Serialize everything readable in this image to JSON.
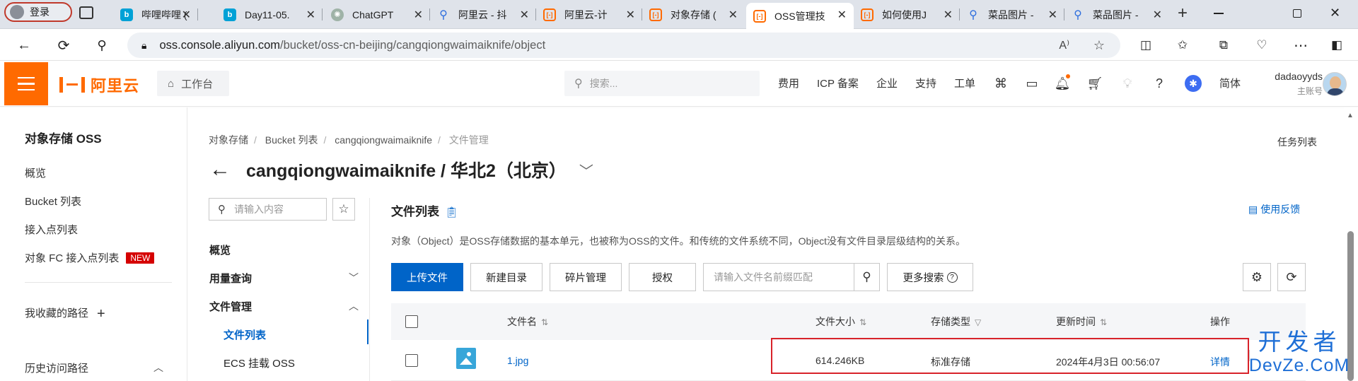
{
  "browser": {
    "login_label": "登录",
    "tabs": [
      {
        "label": "哔哩哔哩 (",
        "icon": "bilibili-icon"
      },
      {
        "label": "Day11-05.",
        "icon": "bilibili-icon"
      },
      {
        "label": "ChatGPT",
        "icon": "chatgpt-icon"
      },
      {
        "label": "阿里云 - 抖",
        "icon": "search-icon"
      },
      {
        "label": "阿里云-计",
        "icon": "aliyun-icon"
      },
      {
        "label": "对象存储 (",
        "icon": "aliyun-icon"
      },
      {
        "label": "OSS管理技",
        "icon": "aliyun-icon"
      },
      {
        "label": "如何使用J",
        "icon": "aliyun-icon"
      },
      {
        "label": "菜品图片 -",
        "icon": "search-icon"
      },
      {
        "label": "菜品图片 -",
        "icon": "search-icon"
      }
    ],
    "url_host": "oss.console.aliyun.com",
    "url_path": "/bucket/oss-cn-beijing/cangqiongwaimaiknife/object"
  },
  "header": {
    "logo_text": "阿里云",
    "workbench": "工作台",
    "search_placeholder": "搜索...",
    "links": [
      "费用",
      "ICP 备案",
      "企业",
      "支持",
      "工单"
    ],
    "lang": "简体",
    "username": "dadaoyyds",
    "role": "主账号"
  },
  "sidebar": {
    "title": "对象存储 OSS",
    "items": [
      "概览",
      "Bucket 列表",
      "接入点列表",
      "对象 FC 接入点列表"
    ],
    "new_badge": "NEW",
    "favorites": "我收藏的路径",
    "history": "历史访问路径"
  },
  "breadcrumb": [
    "对象存储",
    "Bucket 列表",
    "cangqiongwaimaiknife",
    "文件管理"
  ],
  "task_list": "任务列表",
  "bucket_title": "cangqiongwaimaiknife / 华北2（北京）",
  "subnav": {
    "search_placeholder": "请输入内容",
    "overview": "概览",
    "usage": "用量查询",
    "file_mgmt": "文件管理",
    "file_list": "文件列表",
    "ecs_mount": "ECS 挂载 OSS"
  },
  "content": {
    "title": "文件列表",
    "feedback": "使用反馈",
    "description": "对象（Object）是OSS存储数据的基本单元，也被称为OSS的文件。和传统的文件系统不同，Object没有文件目录层级结构的关系。",
    "buttons": {
      "upload": "上传文件",
      "new_dir": "新建目录",
      "fragments": "碎片管理",
      "authorize": "授权",
      "search_placeholder": "请输入文件名前缀匹配",
      "more_search": "更多搜索"
    },
    "table": {
      "headers": [
        "文件名",
        "文件大小",
        "存储类型",
        "更新时间",
        "操作"
      ],
      "rows": [
        {
          "name": "1.jpg",
          "size": "614.246KB",
          "storage": "标准存储",
          "updated": "2024年4月3日 00:56:07",
          "action": "详情"
        }
      ]
    }
  },
  "watermark": {
    "line1": "开发者",
    "line2": "DevZe.CoM"
  },
  "colors": {
    "brand": "#ff6a00",
    "primary": "#0064c8",
    "highlight_box": "#d8232a"
  }
}
